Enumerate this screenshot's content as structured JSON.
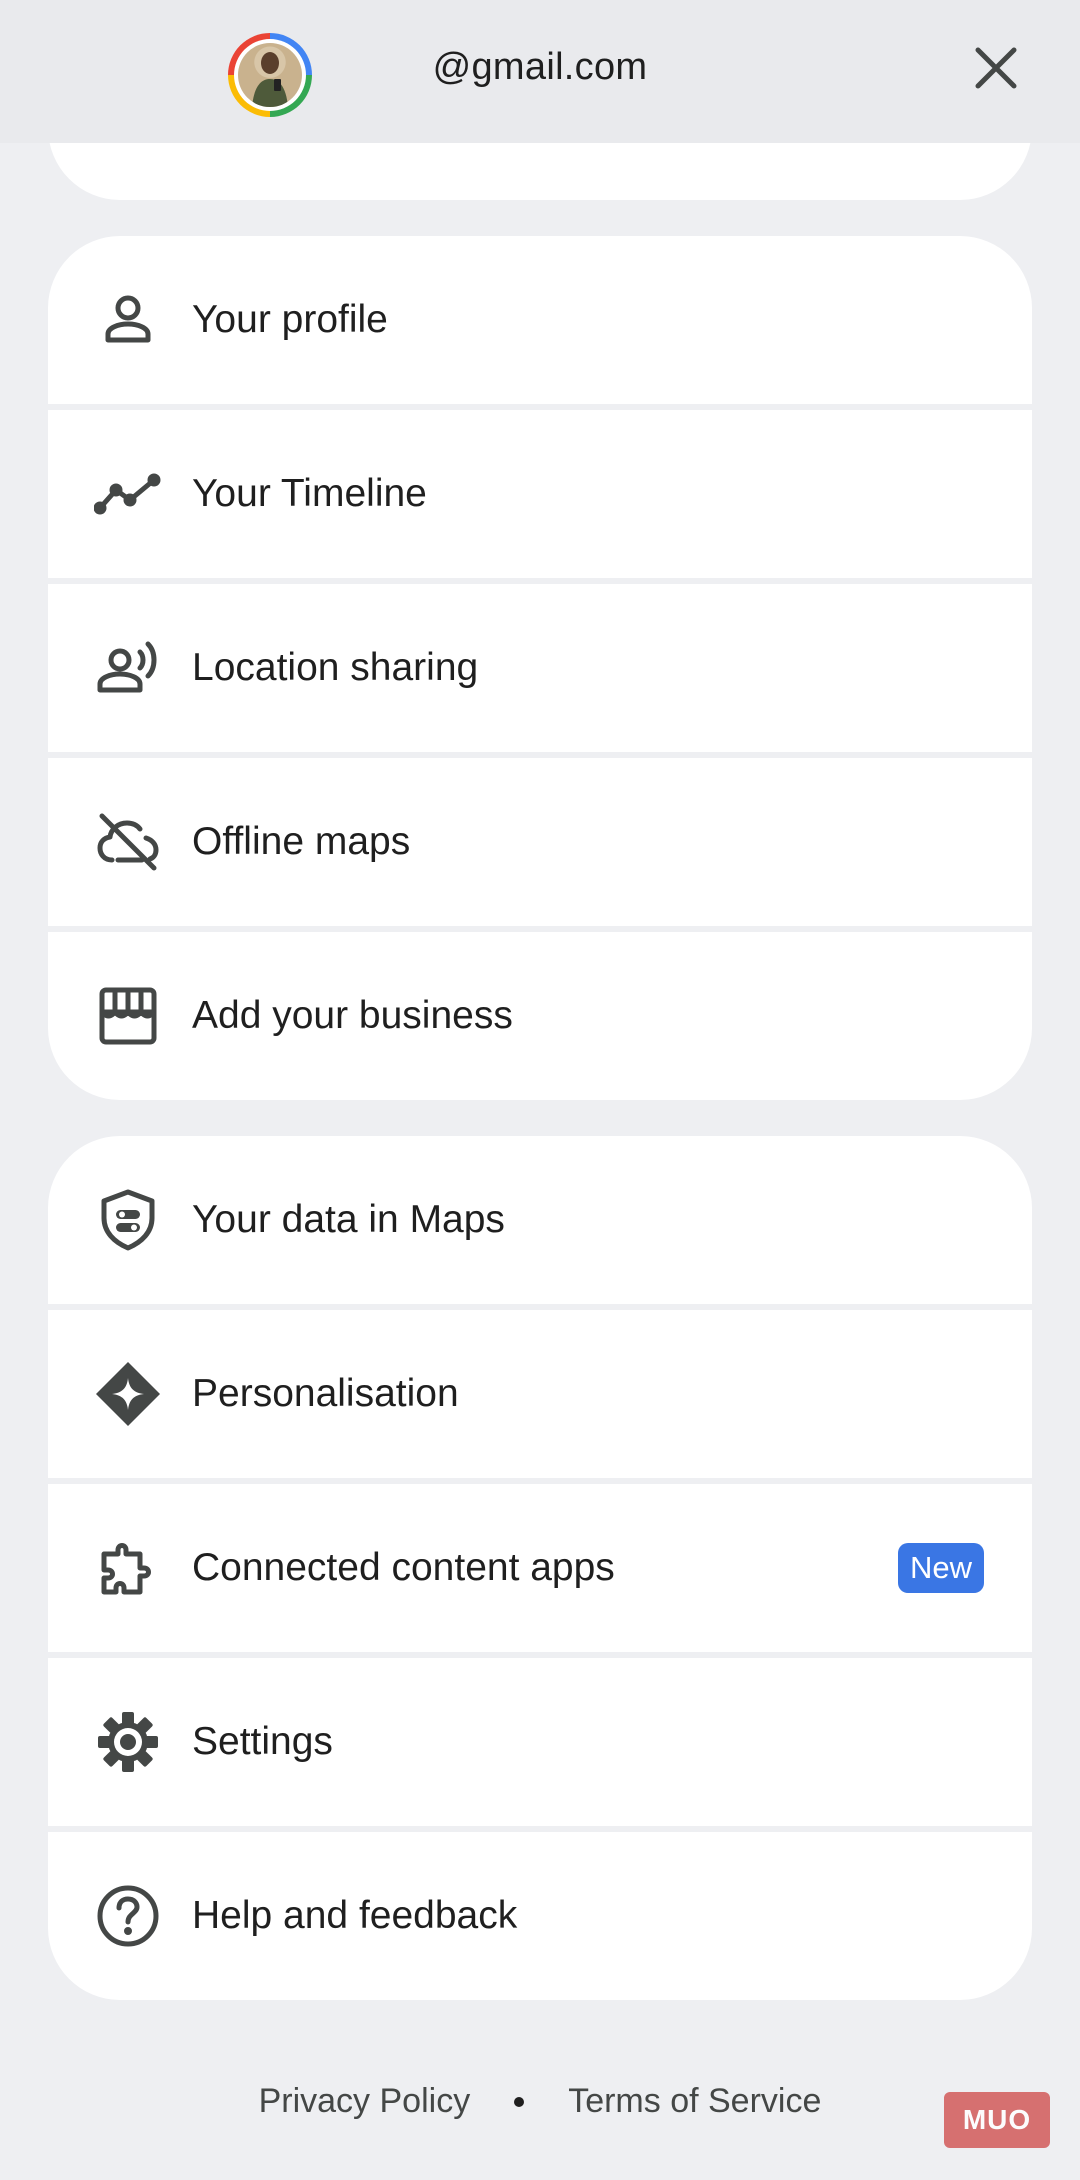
{
  "header": {
    "email": "@gmail.com",
    "close_icon": "close-icon",
    "avatar": "profile-photo"
  },
  "groups": [
    {
      "items": [
        {
          "label": "Your profile",
          "icon": "person-icon"
        },
        {
          "label": "Your Timeline",
          "icon": "timeline-icon"
        },
        {
          "label": "Location sharing",
          "icon": "location-sharing-icon"
        },
        {
          "label": "Offline maps",
          "icon": "cloud-off-icon"
        },
        {
          "label": "Add your business",
          "icon": "storefront-icon"
        }
      ]
    },
    {
      "items": [
        {
          "label": "Your data in Maps",
          "icon": "shield-toggle-icon"
        },
        {
          "label": "Personalisation",
          "icon": "sparkle-diamond-icon"
        },
        {
          "label": "Connected content apps",
          "icon": "puzzle-icon",
          "badge": "New"
        },
        {
          "label": "Settings",
          "icon": "gear-icon"
        },
        {
          "label": "Help and feedback",
          "icon": "help-icon"
        }
      ]
    }
  ],
  "footer": {
    "privacy": "Privacy Policy",
    "terms": "Terms of Service"
  },
  "watermark": "MUO",
  "colors": {
    "background": "#eeeff2",
    "card": "#ffffff",
    "badge": "#3a76e4",
    "icon": "#444746"
  }
}
